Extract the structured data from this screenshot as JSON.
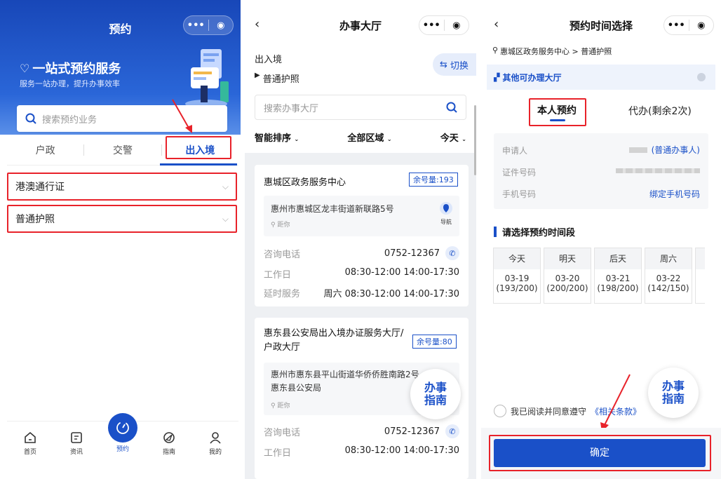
{
  "colors": {
    "brand": "#1a50c8",
    "accent_red": "#e8222a",
    "bg_gray": "#eef0f3"
  },
  "panel1": {
    "title": "预约",
    "banner_title": "一站式预约服务",
    "banner_subtitle": "服务一站办理，提升办事效率",
    "search_placeholder": "搜索预约业务",
    "tabs": [
      "户政",
      "交警",
      "出入境"
    ],
    "active_tab": 2,
    "categories": [
      "港澳通行证",
      "普通护照"
    ],
    "bottom_nav": [
      "首页",
      "资讯",
      "预约",
      "指南",
      "我的"
    ],
    "active_nav": 2,
    "icons": [
      "heart-hand-icon",
      "search-icon",
      "chevron-down-icon",
      "home-icon",
      "news-icon",
      "appointment-icon",
      "guide-icon",
      "profile-icon"
    ]
  },
  "panel2": {
    "title": "办事大厅",
    "crumb_main": "出入境",
    "crumb_sub": "普通护照",
    "switch_label": "切换",
    "search_placeholder": "搜索办事大厅",
    "filters": [
      "智能排序",
      "全部区域",
      "今天"
    ],
    "halls": [
      {
        "name": "惠城区政务服务中心",
        "quota": "余号量:193",
        "address": "惠州市惠城区龙丰街道新联路5号",
        "distance": "距你",
        "nav": "导航",
        "phone_label": "咨询电话",
        "phone": "0752-12367",
        "workday_label": "工作日",
        "workday_hours": "08:30-12:00 14:00-17:30",
        "ext_label": "延时服务",
        "ext_hours": "周六 08:30-12:00 14:00-17:30"
      },
      {
        "name": "惠东县公安局出入境办证服务大厅/户政大厅",
        "quota": "余号量:80",
        "address": "惠州市惠东县平山街道华侨侨胜南路2号惠东县公安局",
        "distance": "距你",
        "phone_label": "咨询电话",
        "phone": "0752-12367",
        "workday_label": "工作日",
        "workday_hours": "08:30-12:00 14:00-17:30"
      }
    ],
    "guide_badge": "办事指南"
  },
  "panel3": {
    "title": "预约时间选择",
    "crumb": "惠城区政务服务中心 > 普通护照",
    "other_halls": "其他可办理大厅",
    "tab_self": "本人预约",
    "tab_proxy": "代办(剩余2次)",
    "applicant_label": "申请人",
    "applicant_value": "(普通办事人)",
    "id_label": "证件号码",
    "phone_label": "手机号码",
    "phone_action": "绑定手机号码",
    "section_title": "请选择预约时间段",
    "days": [
      {
        "day": "今天",
        "date": "03-19",
        "quota": "(193/200)"
      },
      {
        "day": "明天",
        "date": "03-20",
        "quota": "(200/200)"
      },
      {
        "day": "后天",
        "date": "03-21",
        "quota": "(198/200)"
      },
      {
        "day": "周六",
        "date": "03-22",
        "quota": "(142/150)"
      }
    ],
    "agree_text": "我已阅读并同意遵守",
    "terms": "《相关条款》",
    "confirm": "确定",
    "guide_badge": "办事指南"
  }
}
